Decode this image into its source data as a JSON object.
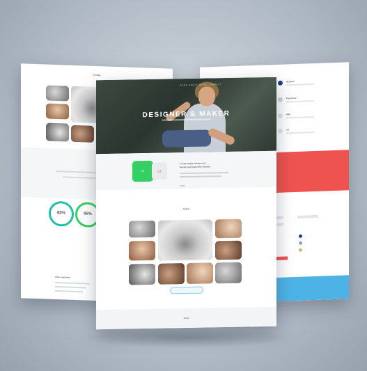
{
  "scene": {
    "name": "Website mockup presentation"
  },
  "left_page": {
    "header_title": "Portfolio",
    "skills": [
      {
        "value": "85%"
      },
      {
        "value": "85%"
      }
    ],
    "footer_title": "Work experience"
  },
  "center_page": {
    "nav_text": "HOME  ABOUT  WORK  CONTACT",
    "hero_title": "DESIGNER & MAKER",
    "green_badge": "UI",
    "gray_badge": "UX",
    "intro_line1": "I create simple interfaces for",
    "intro_line2": "humans and responsive websites",
    "gallery_title": "Gallery",
    "footer_text": "About"
  },
  "right_page": {
    "list": [
      {
        "title": "Illustrator",
        "color": "#1e3a8a"
      },
      {
        "title": "Photoshop",
        "color": "#e0e0e0"
      },
      {
        "title": "Web",
        "color": "#f2f2f2"
      },
      {
        "title": "UX",
        "color": "#f2f2f2"
      }
    ],
    "accent_red": "#ef5350",
    "accent_blue": "#4db3e6"
  },
  "colors": {
    "green": "#35d064",
    "teal": "#1fbfa6"
  }
}
